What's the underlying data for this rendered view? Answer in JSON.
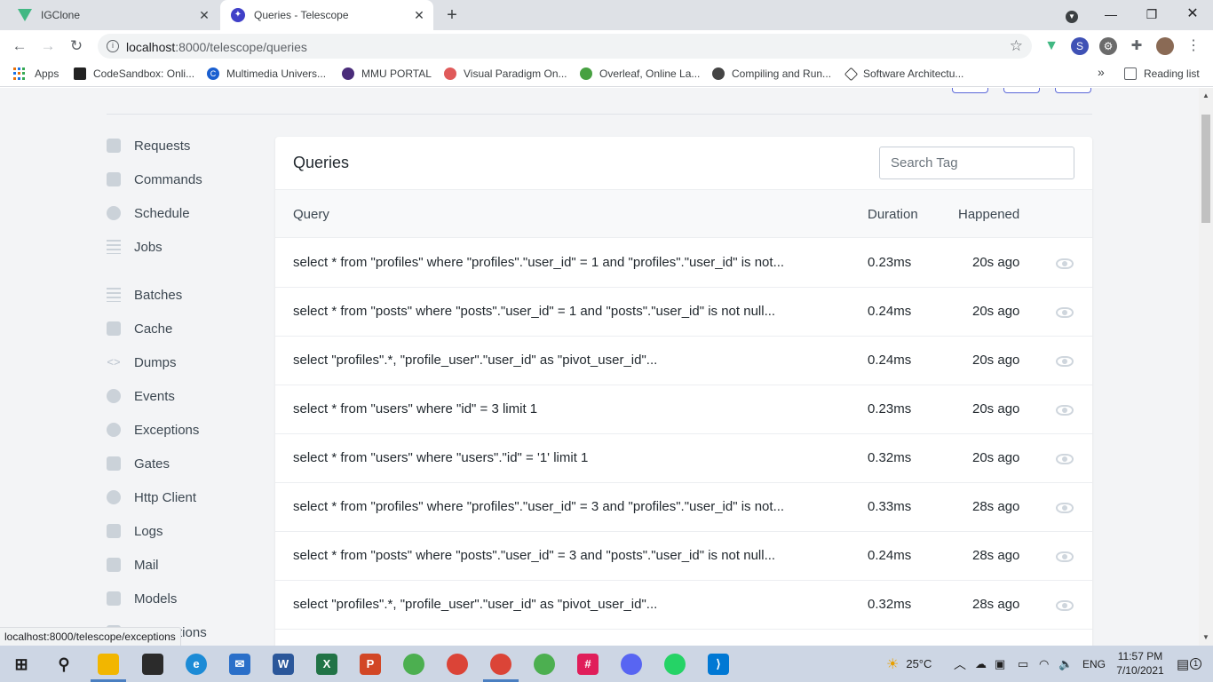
{
  "browser": {
    "tabs": [
      {
        "title": "IGClone",
        "favicon": "vue-icon"
      },
      {
        "title": "Queries - Telescope",
        "favicon": "telescope-icon",
        "active": true
      }
    ],
    "url_host": "localhost",
    "url_rest": ":8000/telescope/queries",
    "bookmarks": [
      {
        "label": "Apps"
      },
      {
        "label": "CodeSandbox: Onli..."
      },
      {
        "label": "Multimedia Univers..."
      },
      {
        "label": "MMU PORTAL"
      },
      {
        "label": "Visual Paradigm On..."
      },
      {
        "label": "Overleaf, Online La..."
      },
      {
        "label": "Compiling and Run..."
      },
      {
        "label": "Software Architectu..."
      }
    ],
    "more_bookmarks": "»",
    "reading_list": "Reading list",
    "status_url": "localhost:8000/telescope/exceptions"
  },
  "sidebar": {
    "items": [
      {
        "label": "Requests",
        "icon": "requests-icon"
      },
      {
        "label": "Commands",
        "icon": "monitor-icon"
      },
      {
        "label": "Schedule",
        "icon": "clock-icon"
      },
      {
        "label": "Jobs",
        "icon": "list-icon"
      },
      {
        "label": "Batches",
        "icon": "list-icon"
      },
      {
        "label": "Cache",
        "icon": "document-icon"
      },
      {
        "label": "Dumps",
        "icon": "code-icon"
      },
      {
        "label": "Events",
        "icon": "headphones-icon"
      },
      {
        "label": "Exceptions",
        "icon": "bug-icon"
      },
      {
        "label": "Gates",
        "icon": "lock-icon"
      },
      {
        "label": "Http Client",
        "icon": "globe-icon"
      },
      {
        "label": "Logs",
        "icon": "archive-icon"
      },
      {
        "label": "Mail",
        "icon": "envelope-icon"
      },
      {
        "label": "Models",
        "icon": "layers-icon"
      },
      {
        "label": "Notifications",
        "icon": "bell-icon"
      }
    ]
  },
  "card": {
    "title": "Queries",
    "search_placeholder": "Search Tag",
    "headers": {
      "query": "Query",
      "duration": "Duration",
      "happened": "Happened"
    },
    "rows": [
      {
        "query": "select * from \"profiles\" where \"profiles\".\"user_id\" = 1 and \"profiles\".\"user_id\" is not...",
        "duration": "0.23ms",
        "happened": "20s ago"
      },
      {
        "query": "select * from \"posts\" where \"posts\".\"user_id\" = 1 and \"posts\".\"user_id\" is not null...",
        "duration": "0.24ms",
        "happened": "20s ago"
      },
      {
        "query": "select \"profiles\".*, \"profile_user\".\"user_id\" as \"pivot_user_id\"...",
        "duration": "0.24ms",
        "happened": "20s ago"
      },
      {
        "query": "select * from \"users\" where \"id\" = 3 limit 1",
        "duration": "0.23ms",
        "happened": "20s ago"
      },
      {
        "query": "select * from \"users\" where \"users\".\"id\" = '1' limit 1",
        "duration": "0.32ms",
        "happened": "20s ago"
      },
      {
        "query": "select * from \"profiles\" where \"profiles\".\"user_id\" = 3 and \"profiles\".\"user_id\" is not...",
        "duration": "0.33ms",
        "happened": "28s ago"
      },
      {
        "query": "select * from \"posts\" where \"posts\".\"user_id\" = 3 and \"posts\".\"user_id\" is not null...",
        "duration": "0.24ms",
        "happened": "28s ago"
      },
      {
        "query": "select \"profiles\".*, \"profile_user\".\"user_id\" as \"pivot_user_id\"...",
        "duration": "0.32ms",
        "happened": "28s ago"
      }
    ]
  },
  "taskbar": {
    "weather": "25°C",
    "language": "ENG",
    "time": "11:57 PM",
    "date": "7/10/2021",
    "notification_count": "1"
  },
  "colors": {
    "accent": "#4040c8",
    "vue_green": "#41b883",
    "sidebar_text": "#3d4852"
  }
}
